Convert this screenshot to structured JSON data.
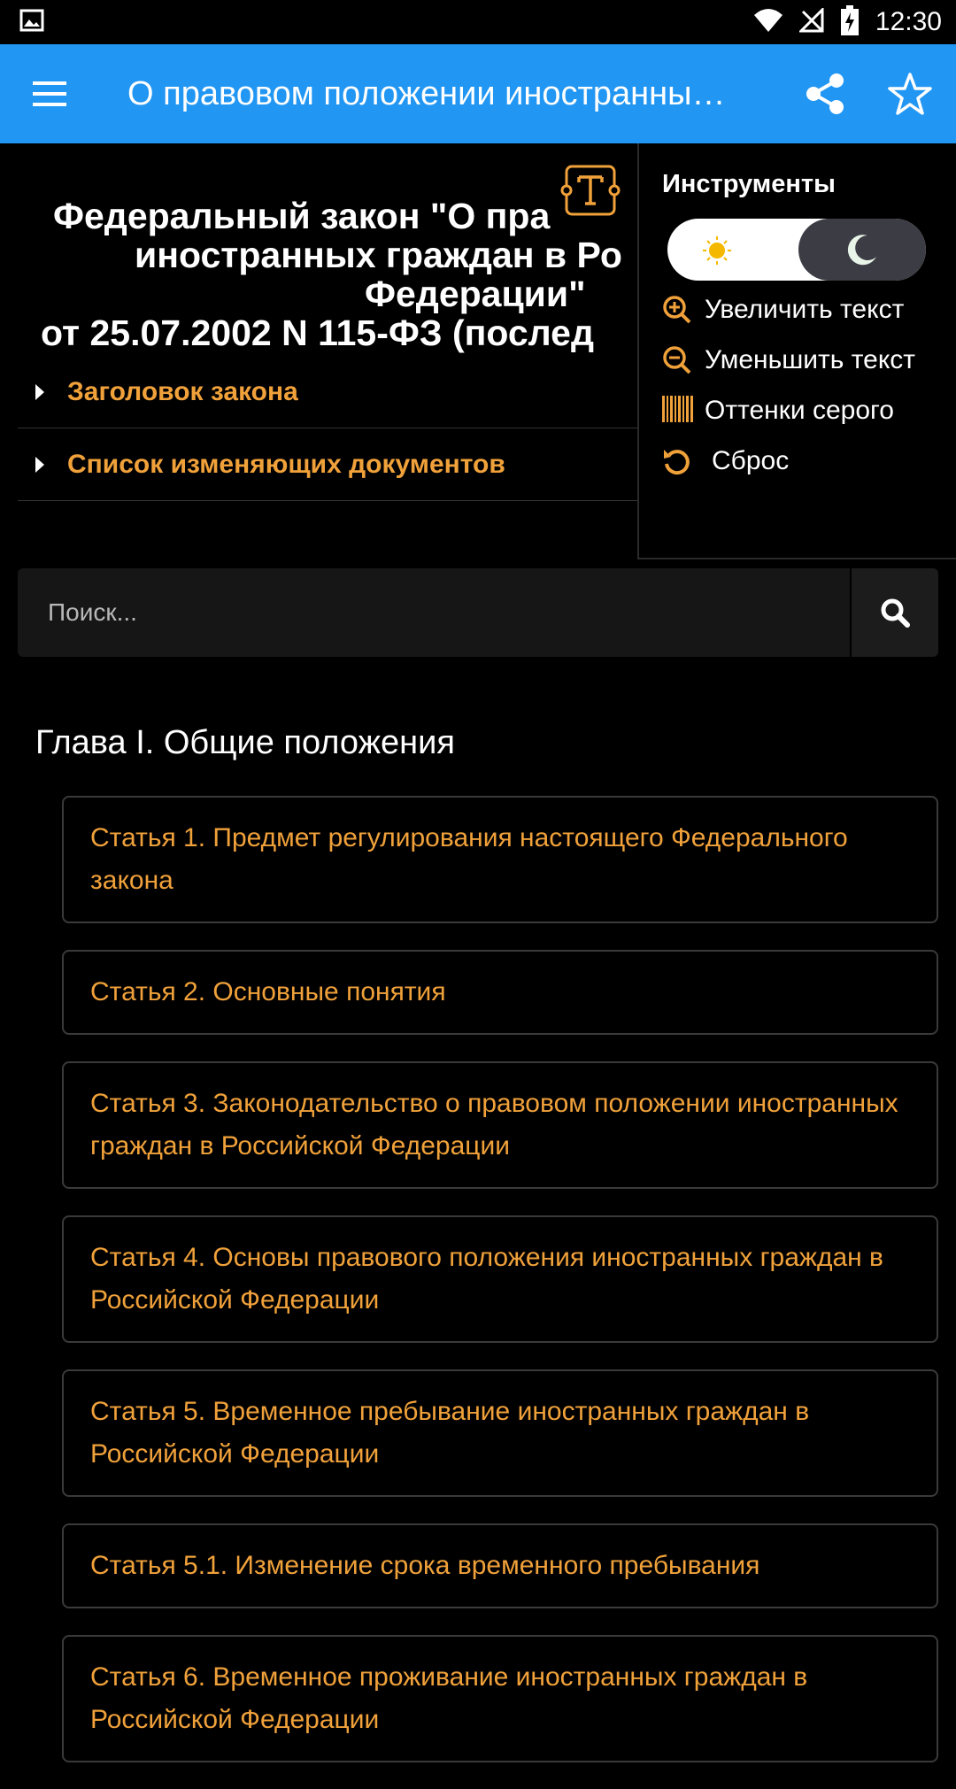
{
  "status_bar": {
    "time": "12:30",
    "icons": [
      "image-icon",
      "wifi-icon",
      "no-signal-icon",
      "battery-charging-icon"
    ]
  },
  "app_bar": {
    "title": "О правовом положении иностранны…",
    "icons": [
      "menu-icon",
      "share-icon",
      "star-icon"
    ],
    "color": "#2196f3"
  },
  "document": {
    "title_line1": "Федеральный закон \"О пра",
    "title_line2": "иностранных граждан в Ро",
    "title_line3": "Федерации\"",
    "title_line4": "от 25.07.2002 N 115-ФЗ (послед",
    "sections": [
      {
        "label": "Заголовок закона"
      },
      {
        "label": "Список изменяющих документов"
      }
    ]
  },
  "search": {
    "placeholder": "Поиск..."
  },
  "chapter": {
    "title": "Глава I. Общие положения",
    "articles": [
      {
        "label": "Статья 1. Предмет регулирования настоящего Федерального закона"
      },
      {
        "label": "Статья 2. Основные понятия"
      },
      {
        "label": "Статья 3. Законодательство о правовом положении иностранных граждан в Российской Федерации"
      },
      {
        "label": "Статья 4. Основы правового положения иностранных граждан в Российской Федерации"
      },
      {
        "label": "Статья 5. Временное пребывание иностранных граждан в Российской Федерации"
      },
      {
        "label": "Статья 5.1. Изменение срока временного пребывания"
      },
      {
        "label": "Статья 6. Временное проживание иностранных граждан в Российской Федерации"
      }
    ]
  },
  "tools": {
    "title": "Инструменты",
    "theme_mode": "dark",
    "items": [
      {
        "label": "Увеличить текст",
        "icon": "zoom-in-icon"
      },
      {
        "label": "Уменьшить текст",
        "icon": "zoom-out-icon"
      },
      {
        "label": "Оттенки серого",
        "icon": "grayscale-icon"
      },
      {
        "label": "Сброс",
        "icon": "reset-icon"
      }
    ]
  },
  "colors": {
    "accent": "#f0a13a",
    "background": "#000000"
  }
}
